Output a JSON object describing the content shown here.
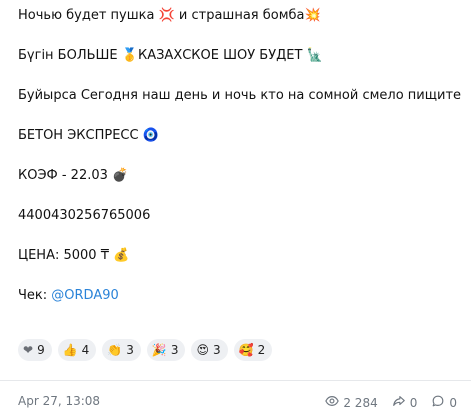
{
  "post": {
    "lines": [
      {
        "text": "Ночью будет пушка ",
        "emoji1": "💢",
        "text2": " и страшная бомба",
        "emoji2": "💥"
      },
      {
        "text": "Бүгін БОЛЬШЕ ",
        "emoji1": "🥇",
        "text2": "КАЗАХСКОЕ ШОУ БУДЕТ ",
        "emoji2": "🗽"
      },
      {
        "text": "Буйырса Сегодня наш день и ночь кто на сомной смело пищите"
      },
      {
        "text": "БЕТОН ЭКСПРЕСС ",
        "emoji1": "🧿"
      },
      {
        "text": "КОЭФ - 22.03 ",
        "emoji1": "💣"
      },
      {
        "text": "4400430256765006"
      },
      {
        "text": "ЦЕНА: 5000 ₸ ",
        "emoji1": "💰"
      },
      {
        "text": "Чек: ",
        "link": "@ORDA90"
      }
    ]
  },
  "reactions": [
    {
      "emoji": "❤",
      "count": "9"
    },
    {
      "emoji": "👍",
      "count": "4"
    },
    {
      "emoji": "👏",
      "count": "3"
    },
    {
      "emoji": "🎉",
      "count": "3"
    },
    {
      "emoji": "😍",
      "count": "3"
    },
    {
      "emoji": "🥰",
      "count": "2"
    }
  ],
  "footer": {
    "date": "Apr 27, 13:08",
    "views": "2 284",
    "shares": "0",
    "comments": "0"
  },
  "colors": {
    "link": "#2a83d8",
    "reaction_bg": "#eef0f3",
    "muted": "#6f7780"
  }
}
